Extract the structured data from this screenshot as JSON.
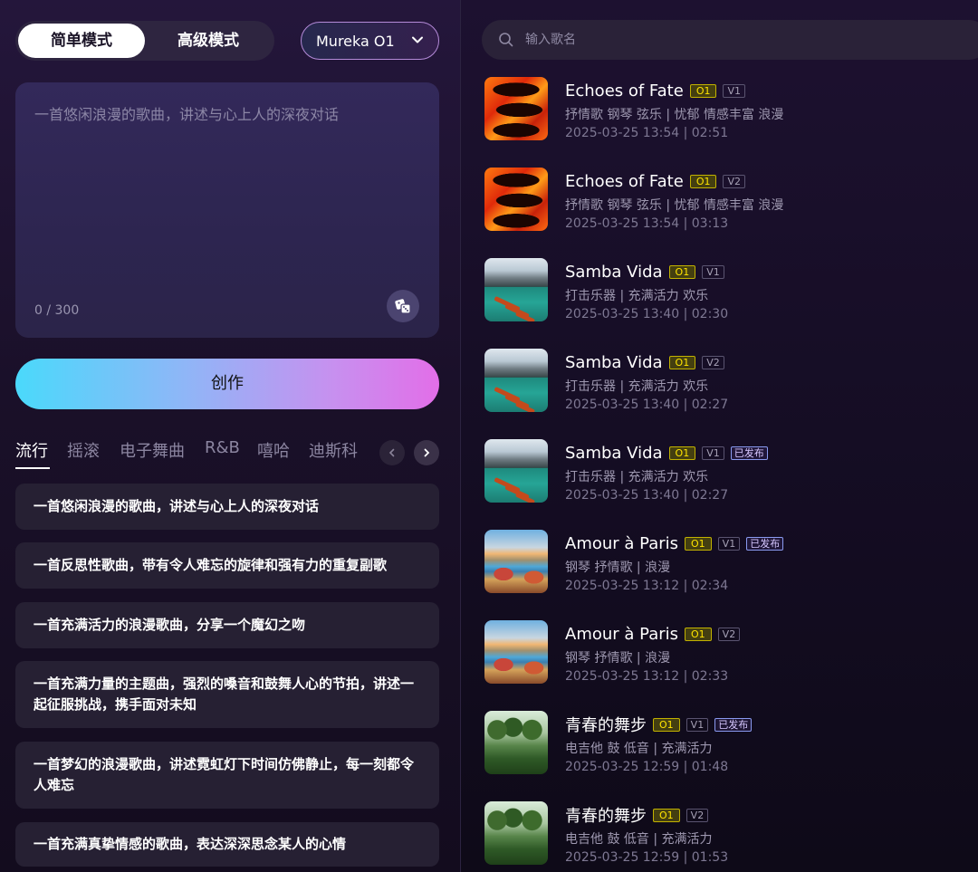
{
  "mode_toggle": {
    "simple": "简单模式",
    "advanced": "高级模式"
  },
  "model_select": {
    "label": "Mureka O1",
    "icon": "chevron-down-icon"
  },
  "prompt": {
    "placeholder": "一首悠闲浪漫的歌曲，讲述与心上人的深夜对话",
    "value": "",
    "char_count": "0 / 300",
    "random_icon": "dice-icon"
  },
  "create_button": "创作",
  "genre_tabs": [
    "流行",
    "摇滚",
    "电子舞曲",
    "R&B",
    "嘻哈",
    "迪斯科"
  ],
  "active_tab": "流行",
  "suggestions": [
    "一首悠闲浪漫的歌曲，讲述与心上人的深夜对话",
    "一首反思性歌曲，带有令人难忘的旋律和强有力的重复副歌",
    "一首充满活力的浪漫歌曲，分享一个魔幻之吻",
    "一首充满力量的主题曲，强烈的嗓音和鼓舞人心的节拍，讲述一起征服挑战，携手面对未知",
    "一首梦幻的浪漫歌曲，讲述霓虹灯下时间仿佛静止，每一刻都令人难忘",
    "一首充满真挚情感的歌曲，表达深深思念某人的心情"
  ],
  "search": {
    "placeholder": "输入歌名",
    "icon": "search-icon"
  },
  "songs": [
    {
      "title": "Echoes of Fate",
      "model": "O1",
      "version": "V1",
      "published": "",
      "tags": "抒情歌 钢琴 弦乐 | 忧郁 情感丰富 浪漫",
      "meta": "2025-03-25 13:54  | 02:51",
      "cover": "fire"
    },
    {
      "title": "Echoes of Fate",
      "model": "O1",
      "version": "V2",
      "published": "",
      "tags": "抒情歌 钢琴 弦乐 | 忧郁 情感丰富 浪漫",
      "meta": "2025-03-25 13:54  | 03:13",
      "cover": "fire"
    },
    {
      "title": "Samba Vida",
      "model": "O1",
      "version": "V1",
      "published": "",
      "tags": "打击乐器 | 充满活力 欢乐",
      "meta": "2025-03-25 13:40  | 02:30",
      "cover": "lake"
    },
    {
      "title": "Samba Vida",
      "model": "O1",
      "version": "V2",
      "published": "",
      "tags": "打击乐器 | 充满活力 欢乐",
      "meta": "2025-03-25 13:40  | 02:27",
      "cover": "lake"
    },
    {
      "title": "Samba Vida",
      "model": "O1",
      "version": "V1",
      "published": "已发布",
      "tags": "打击乐器 | 充满活力 欢乐",
      "meta": "2025-03-25 13:40  | 02:27",
      "cover": "lake"
    },
    {
      "title": "Amour à Paris",
      "model": "O1",
      "version": "V1",
      "published": "已发布",
      "tags": "钢琴 抒情歌 | 浪漫",
      "meta": "2025-03-25 13:12  | 02:34",
      "cover": "paris"
    },
    {
      "title": "Amour à Paris",
      "model": "O1",
      "version": "V2",
      "published": "",
      "tags": "钢琴 抒情歌 | 浪漫",
      "meta": "2025-03-25 13:12  | 02:33",
      "cover": "paris"
    },
    {
      "title": "青春的舞步",
      "model": "O1",
      "version": "V1",
      "published": "已发布",
      "tags": "电吉他 鼓 低音 | 充满活力",
      "meta": "2025-03-25 12:59  | 01:48",
      "cover": "trees"
    },
    {
      "title": "青春的舞步",
      "model": "O1",
      "version": "V2",
      "published": "",
      "tags": "电吉他 鼓 低音 | 充满活力",
      "meta": "2025-03-25 12:59  | 01:53",
      "cover": "trees"
    }
  ],
  "colors": {
    "accent_gradient_start": "#4ad9fb",
    "accent_gradient_end": "#e26ee8",
    "o1_badge": "#ffe400",
    "published_badge": "#8a9af0"
  }
}
